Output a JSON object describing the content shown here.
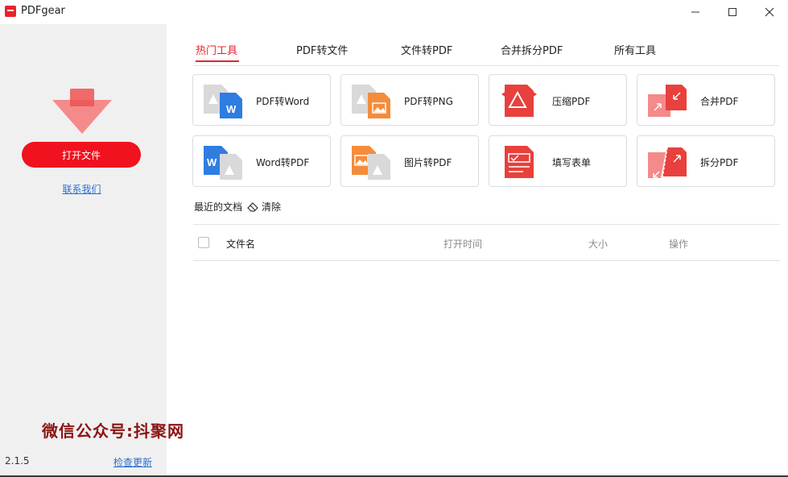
{
  "window": {
    "title": "PDFgear",
    "minimize": "—",
    "maximize": "☐",
    "close": "✕"
  },
  "sidebar": {
    "open_file": "打开文件",
    "contact": "联系我们",
    "watermark": "微信公众号:抖聚网",
    "version": "2.1.5",
    "check_update": "检查更新"
  },
  "tabs": [
    "热门工具",
    "PDF转文件",
    "文件转PDF",
    "合并拆分PDF",
    "所有工具"
  ],
  "tools": [
    {
      "label": "PDF转Word",
      "icon": "pdf-to-word-icon"
    },
    {
      "label": "PDF转PNG",
      "icon": "pdf-to-png-icon"
    },
    {
      "label": "压缩PDF",
      "icon": "compress-pdf-icon"
    },
    {
      "label": "合并PDF",
      "icon": "merge-pdf-icon"
    },
    {
      "label": "Word转PDF",
      "icon": "word-to-pdf-icon"
    },
    {
      "label": "图片转PDF",
      "icon": "image-to-pdf-icon"
    },
    {
      "label": "填写表单",
      "icon": "fill-form-icon"
    },
    {
      "label": "拆分PDF",
      "icon": "split-pdf-icon"
    }
  ],
  "recent": {
    "title": "最近的文档",
    "clear": "清除",
    "columns": {
      "name": "文件名",
      "time": "打开时间",
      "size": "大小",
      "actions": "操作"
    }
  },
  "colors": {
    "accent": "#e8232b",
    "button": "#f0121e",
    "link": "#2b6fd1",
    "sidebar_bg": "#f0f0f0"
  }
}
